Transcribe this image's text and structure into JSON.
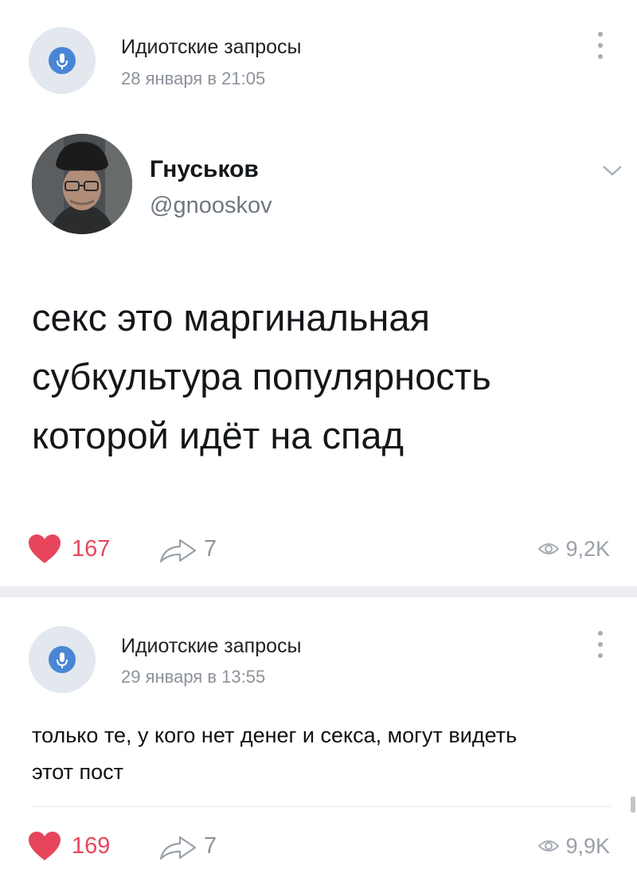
{
  "posts": [
    {
      "group_name": "Идиотские запросы",
      "date": "28 января в 21:05",
      "tweet": {
        "author_name": "Гнуськов",
        "author_handle": "@gnooskov",
        "lines": [
          "секс это маргинальная",
          "субкультура популярность",
          "которой идёт на спад"
        ]
      },
      "likes": "167",
      "shares": "7",
      "views": "9,2K"
    },
    {
      "group_name": "Идиотские запросы",
      "date": "29 января в 13:55",
      "lines": [
        "только те, у кого нет денег и секса, могут видеть",
        "этот пост"
      ],
      "likes": "169",
      "shares": "7",
      "views": "9,9K"
    }
  ],
  "icons": {
    "group_avatar": "microphone-icon",
    "menu": "more-vertical-icon",
    "like": "heart-icon",
    "share": "share-arrow-icon",
    "views": "eye-icon",
    "tweet_menu": "chevron-down-icon"
  },
  "colors": {
    "like": "#e6455c",
    "accent": "#4a86d6",
    "secondary_text": "#8c929b"
  }
}
